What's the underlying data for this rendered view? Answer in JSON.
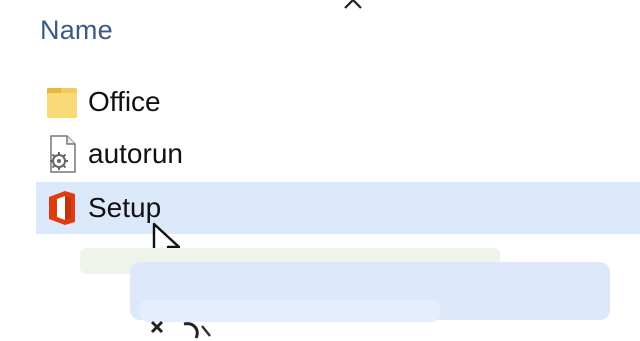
{
  "explorer": {
    "column_header": "Name",
    "files": [
      {
        "name": "Office",
        "type": "folder",
        "icon": "folder-icon",
        "selected": false
      },
      {
        "name": "autorun",
        "type": "settings-file",
        "icon": "settings-file-icon",
        "selected": false
      },
      {
        "name": "Setup",
        "type": "application",
        "icon": "office-logo-icon",
        "selected": true
      }
    ]
  },
  "colors": {
    "header_text": "#3a5a86",
    "selection_background": "#dbe9fb",
    "folder_yellow": "#f4c95d",
    "office_orange": "#e03c12"
  }
}
